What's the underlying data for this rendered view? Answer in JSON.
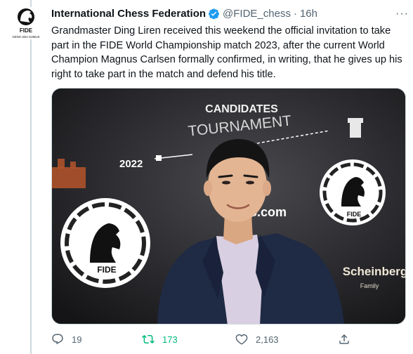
{
  "tweet": {
    "author_name": "International Chess Federation",
    "handle": "@FIDE_chess",
    "separator": "·",
    "time": "16h",
    "more": "···",
    "text": "Grandmaster Ding Liren received this weekend the official invitation to take part in the FIDE World Championship match 2023, after the current World Champion Magnus Carlsen formally confirmed, in writing, that he gives up his right to take part in the match and defend his title."
  },
  "avatar": {
    "logo_text": "FIDE",
    "motto": "GENS UNA SUMUS"
  },
  "photo": {
    "banner_line1": "CANDIDATES",
    "banner_line2": "TOURNAMENT",
    "year": "2022",
    "left_logo": "FIDE",
    "right_logo": "FIDE",
    "sponsor_fragment": "S.com",
    "sponsor_name": "Scheinberg",
    "sponsor_sub": "Family"
  },
  "actions": {
    "replies": "19",
    "retweets": "173",
    "likes": "2,163"
  },
  "colors": {
    "verified_blue": "#1d9bf0",
    "retweet_green": "#00ba7c",
    "secondary_text": "#536471"
  },
  "icons": [
    "fide-logo-icon",
    "verified-badge-icon",
    "more-icon",
    "reply-icon",
    "retweet-icon",
    "like-icon",
    "share-icon"
  ]
}
